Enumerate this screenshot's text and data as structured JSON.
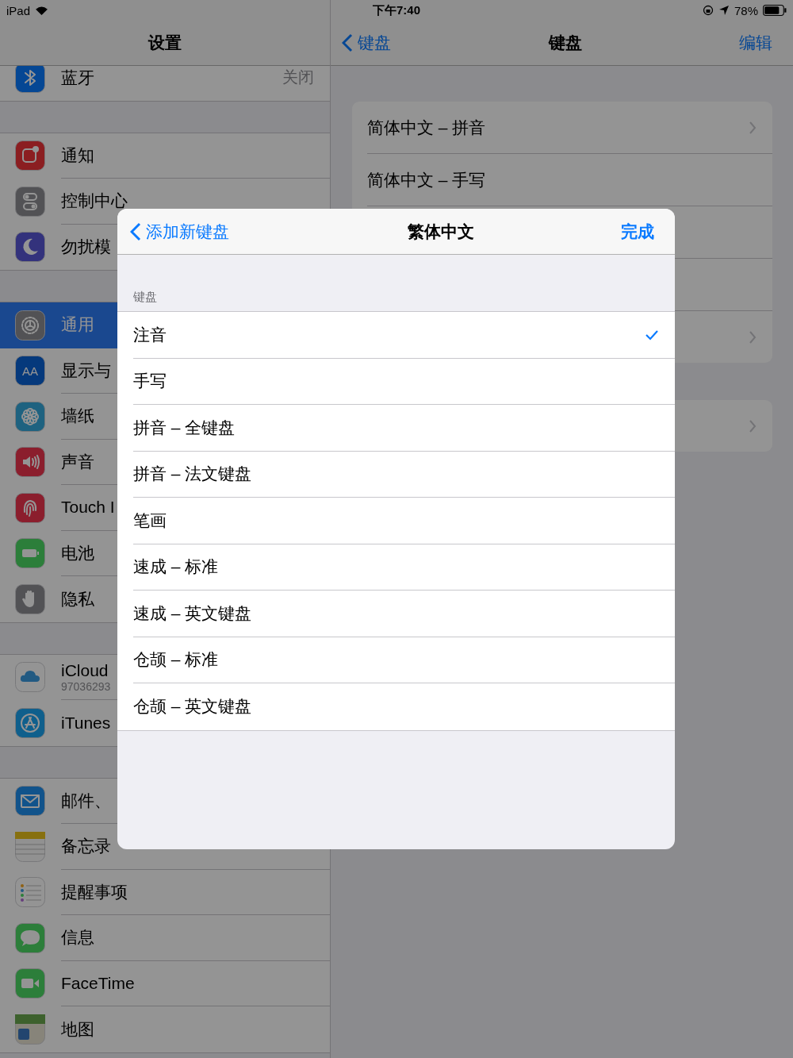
{
  "status_bar": {
    "device": "iPad",
    "time": "下午7:40",
    "battery": "78%"
  },
  "sidebar": {
    "title": "设置",
    "groups": [
      [
        {
          "label": "蓝牙",
          "value": "关闭",
          "kind": "bluetooth",
          "selected": false
        }
      ],
      [
        {
          "label": "通知",
          "kind": "notifications",
          "selected": false
        },
        {
          "label": "控制中心",
          "kind": "control",
          "selected": false
        },
        {
          "label": "勿扰模",
          "kind": "moon",
          "selected": false
        }
      ],
      [
        {
          "label": "通用",
          "kind": "general",
          "selected": true
        },
        {
          "label": "显示与",
          "kind": "display",
          "icon_text": "AA",
          "selected": false
        },
        {
          "label": "墙纸",
          "kind": "wallpaper",
          "selected": false
        },
        {
          "label": "声音",
          "kind": "sounds",
          "selected": false
        },
        {
          "label": "Touch I",
          "kind": "touchid",
          "selected": false
        },
        {
          "label": "电池",
          "kind": "battery",
          "selected": false
        },
        {
          "label": "隐私",
          "kind": "privacy",
          "selected": false
        }
      ],
      [
        {
          "label": "iCloud",
          "subtitle": "97036293",
          "kind": "icloud",
          "selected": false
        },
        {
          "label": "iTunes",
          "kind": "itunes",
          "selected": false
        }
      ],
      [
        {
          "label": "邮件、",
          "kind": "mail",
          "selected": false
        },
        {
          "label": "备忘录",
          "kind": "notes",
          "selected": false
        },
        {
          "label": "提醒事项",
          "kind": "reminders",
          "selected": false
        },
        {
          "label": "信息",
          "kind": "messages",
          "selected": false
        },
        {
          "label": "FaceTime",
          "kind": "facetime",
          "selected": false
        },
        {
          "label": "地图",
          "kind": "maps",
          "selected": false
        }
      ]
    ]
  },
  "detail": {
    "back": "键盘",
    "title": "键盘",
    "action": "编辑",
    "groups": [
      [
        {
          "label": "简体中文 – 拼音",
          "chevron": true
        },
        {
          "label": "简体中文 – 手写",
          "chevron": false
        },
        {
          "chevron": false
        },
        {
          "chevron": false
        },
        {
          "chevron": true
        }
      ],
      [
        {
          "chevron": true
        }
      ]
    ]
  },
  "sheet": {
    "back": "添加新键盘",
    "title": "繁体中文",
    "done": "完成",
    "section": "键盘",
    "items": [
      {
        "label": "注音",
        "selected": true
      },
      {
        "label": "手写",
        "selected": false
      },
      {
        "label": "拼音 – 全键盘",
        "selected": false
      },
      {
        "label": "拼音 – 法文键盘",
        "selected": false
      },
      {
        "label": "笔画",
        "selected": false
      },
      {
        "label": "速成 – 标准",
        "selected": false
      },
      {
        "label": "速成 – 英文键盘",
        "selected": false
      },
      {
        "label": "仓颉 – 标准",
        "selected": false
      },
      {
        "label": "仓颉 – 英文键盘",
        "selected": false
      }
    ]
  }
}
